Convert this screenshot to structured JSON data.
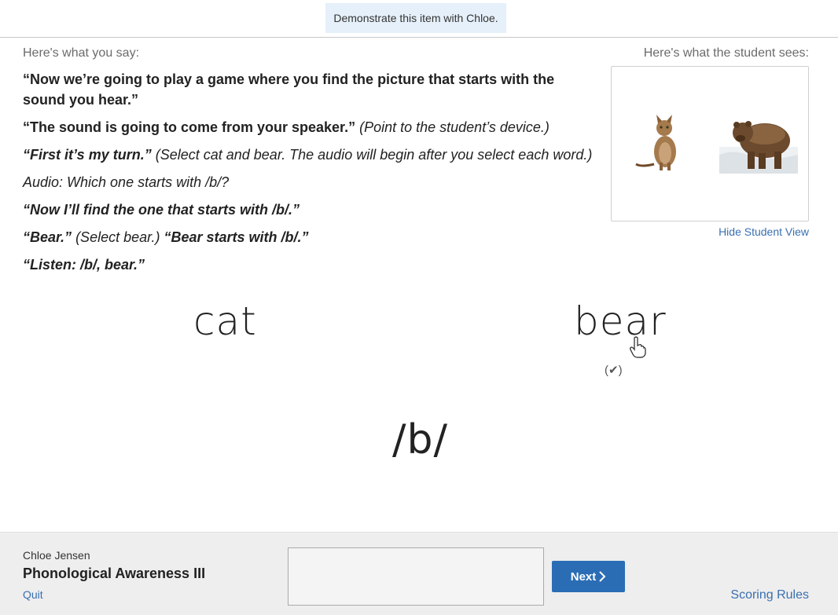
{
  "banner": {
    "text": "Demonstrate this item with Chloe."
  },
  "say_heading": "Here's what you say:",
  "sees_heading": "Here's what the student sees:",
  "script": {
    "line1": "“Now we’re going to play a game where you find the picture that starts with the sound you hear.”",
    "line2_bold": "“The sound is going to come from your speaker.”",
    "line2_italic": "(Point to the student’s device.)",
    "line3_bold_italic": "“First it’s my turn.”",
    "line3_italic": "(Select cat and bear. The audio will begin after you select each word.)",
    "line4": "Audio: Which one starts with /b/?",
    "line5": "“Now I’ll find the one that starts with /b/.”",
    "line6_bold_italic_a": "“Bear.”",
    "line6_italic": "(Select bear.)",
    "line6_bold_italic_b": "“Bear starts with /b/.”",
    "line7": "“Listen: /b/, bear.”"
  },
  "student_view": {
    "hide_link": "Hide Student View",
    "pictures": [
      "cat-image",
      "bear-image"
    ]
  },
  "words": {
    "cat": "cat",
    "bear": "bear",
    "bear_check": "(✔)"
  },
  "target_sound": "/b/",
  "footer": {
    "student_name": "Chloe Jensen",
    "assessment": "Phonological Awareness III",
    "quit": "Quit",
    "notes_value": "",
    "next_label": "Next",
    "scoring_rules": "Scoring Rules"
  },
  "colors": {
    "accent": "#2a6db5",
    "link": "#3a6fb0",
    "banner_bg": "#e6f0fa",
    "footer_bg": "#eeeeee"
  },
  "icons": {
    "next": "chevron-right-icon",
    "cursor": "hand-pointer-icon",
    "check": "check-icon"
  }
}
